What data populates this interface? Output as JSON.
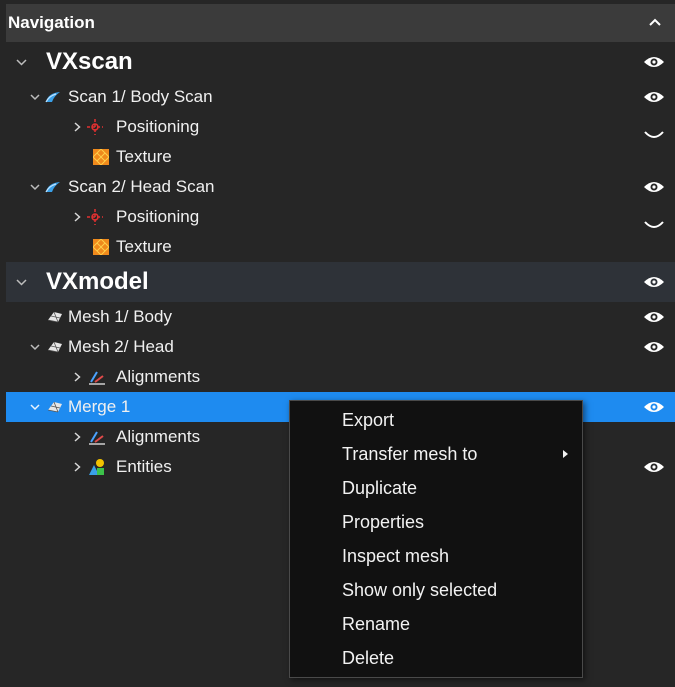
{
  "panel": {
    "title": "Navigation",
    "collapse_icon": "chevron-up-icon"
  },
  "tree": {
    "vxscan": {
      "label": "VXscan",
      "children": [
        {
          "label": "Scan 1/  Body Scan",
          "icon": "scan-icon",
          "children": [
            {
              "label": "Positioning",
              "icon": "positioning-icon"
            },
            {
              "label": "Texture",
              "icon": "texture-icon"
            }
          ]
        },
        {
          "label": "Scan 2/ Head Scan",
          "icon": "scan-icon",
          "children": [
            {
              "label": "Positioning",
              "icon": "positioning-icon"
            },
            {
              "label": "Texture",
              "icon": "texture-icon"
            }
          ]
        }
      ]
    },
    "vxmodel": {
      "label": "VXmodel",
      "children": [
        {
          "label": "Mesh 1/ Body",
          "icon": "mesh-icon"
        },
        {
          "label": "Mesh 2/ Head",
          "icon": "mesh-icon",
          "children": [
            {
              "label": "Alignments",
              "icon": "alignment-icon"
            }
          ]
        },
        {
          "label": "Merge 1",
          "icon": "mesh-icon",
          "selected": true,
          "children": [
            {
              "label": "Alignments",
              "icon": "alignment-icon"
            },
            {
              "label": "Entities",
              "icon": "entities-icon"
            }
          ]
        }
      ]
    }
  },
  "context_menu": {
    "items": [
      {
        "label": "Export"
      },
      {
        "label": "Transfer mesh to",
        "submenu": true
      },
      {
        "label": "Duplicate"
      },
      {
        "label": "Properties"
      },
      {
        "label": "Inspect mesh"
      },
      {
        "label": "Show only selected"
      },
      {
        "label": "Rename"
      },
      {
        "label": "Delete"
      }
    ]
  },
  "colors": {
    "panel_bg": "#262626",
    "header_bg": "#3b3b3b",
    "section_bg": "#2e3238",
    "selection": "#1e8bf0",
    "menu_bg": "#111111",
    "text": "#f0f0f0"
  }
}
